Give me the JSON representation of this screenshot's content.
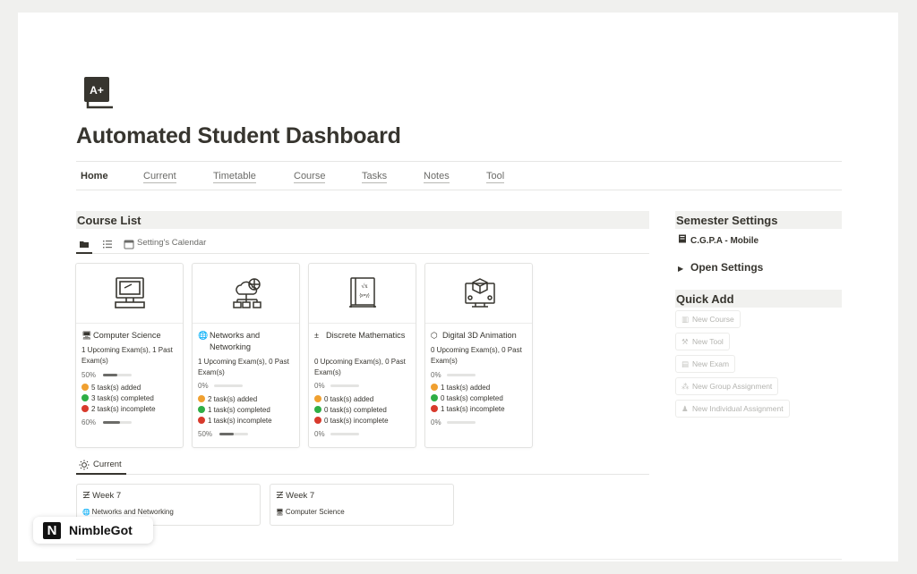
{
  "page": {
    "title": "Automated Student Dashboard",
    "icon": "grade-a-plus-icon",
    "icon_text": "A+"
  },
  "nav": {
    "tabs": [
      {
        "label": "Home",
        "active": true
      },
      {
        "label": "Current"
      },
      {
        "label": "Timetable"
      },
      {
        "label": "Course"
      },
      {
        "label": "Tasks"
      },
      {
        "label": "Notes"
      },
      {
        "label": "Tool"
      }
    ]
  },
  "course_list": {
    "heading": "Course List",
    "view_label": "Setting's Calendar",
    "courses": [
      {
        "icon": "desktop-icon",
        "cover": "computer-monitor-icon",
        "title": "Computer Science",
        "exams": "1 Upcoming Exam(s), 1 Past Exam(s)",
        "exam_progress": "50%",
        "tasks_added": "5 task(s) added",
        "tasks_completed": "3 task(s) completed",
        "tasks_incomplete": "2 task(s) incomplete",
        "task_progress": "60%"
      },
      {
        "icon": "globe-icon",
        "cover": "cloud-network-icon",
        "title": "Networks and Networking",
        "exams": "1 Upcoming Exam(s), 0 Past Exam(s)",
        "exam_progress": "0%",
        "tasks_added": "2 task(s) added",
        "tasks_completed": "1 task(s) completed",
        "tasks_incomplete": "1 task(s) incomplete",
        "task_progress": "50%"
      },
      {
        "icon": "math-operators-icon",
        "cover": "math-notebook-icon",
        "title": "Discrete Mathematics",
        "exams": "0 Upcoming Exam(s), 0 Past Exam(s)",
        "exam_progress": "0%",
        "tasks_added": "0 task(s) added",
        "tasks_completed": "0 task(s) completed",
        "tasks_incomplete": "0 task(s) incomplete",
        "task_progress": "0%"
      },
      {
        "icon": "shapes-icon",
        "cover": "3d-cube-monitor-icon",
        "title": "Digital 3D Animation",
        "exams": "0 Upcoming Exam(s), 0 Past Exam(s)",
        "exam_progress": "0%",
        "tasks_added": "1 task(s) added",
        "tasks_completed": "0 task(s) completed",
        "tasks_incomplete": "1 task(s) incomplete",
        "task_progress": "0%"
      }
    ]
  },
  "current": {
    "tab_label": "Current",
    "weeks": [
      {
        "title": "Week 7",
        "course": "Networks and Networking"
      },
      {
        "title": "Week 7",
        "course": "Computer Science"
      }
    ]
  },
  "semester_settings": {
    "heading": "Semester Settings",
    "cgpa_label": "C.G.P.A - Mobile",
    "toggle_label": "Open Settings"
  },
  "quick_add": {
    "heading": "Quick Add",
    "buttons": [
      {
        "label": "New Course",
        "icon": "book-icon"
      },
      {
        "label": "New Tool",
        "icon": "wrench-icon"
      },
      {
        "label": "New Exam",
        "icon": "document-icon"
      },
      {
        "label": "New Group Assignment",
        "icon": "group-icon"
      },
      {
        "label": "New Individual Assignment",
        "icon": "person-icon"
      }
    ]
  },
  "badge": {
    "letter": "N",
    "name": "NimbleGot"
  },
  "colors": {
    "orange": "#f0a030",
    "green": "#2fae45",
    "red": "#d83a2c",
    "header_bg": "#f1f1ef"
  }
}
